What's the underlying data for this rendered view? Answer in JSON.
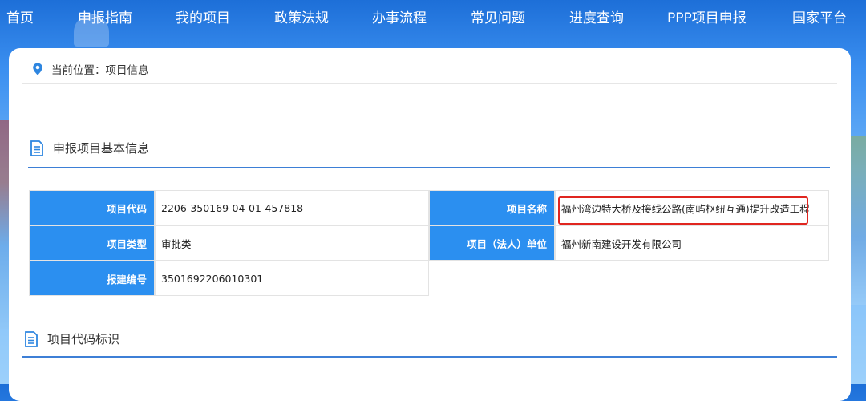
{
  "nav": {
    "items": [
      {
        "label": "首页"
      },
      {
        "label": "申报指南"
      },
      {
        "label": "我的项目"
      },
      {
        "label": "政策法规"
      },
      {
        "label": "办事流程"
      },
      {
        "label": "常见问题"
      },
      {
        "label": "进度查询"
      },
      {
        "label": "PPP项目申报"
      },
      {
        "label": "国家平台"
      }
    ]
  },
  "breadcrumb": {
    "prefix": "当前位置：",
    "current": "项目信息"
  },
  "sections": {
    "basic_info_title": "申报项目基本信息",
    "code_mark_title": "项目代码标识"
  },
  "project": {
    "code_label": "项目代码",
    "code_value": "2206-350169-04-01-457818",
    "name_label": "项目名称",
    "name_value": "福州湾边特大桥及接线公路(南屿枢纽互通)提升改造工程",
    "type_label": "项目类型",
    "type_value": "审批类",
    "entity_label": "项目（法人）单位",
    "entity_value": "福州新南建设开发有限公司",
    "filing_label": "报建编号",
    "filing_value": "3501692206010301"
  },
  "colors": {
    "accent": "#2b8ff0",
    "highlight": "#e0261f",
    "divider": "#3d7fd6"
  },
  "icons": {
    "location": "location-pin-icon",
    "document": "document-icon"
  }
}
